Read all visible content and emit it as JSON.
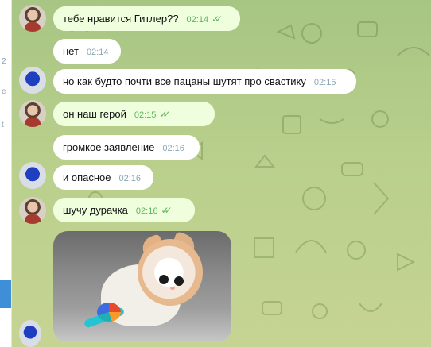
{
  "left_strip": {
    "marks": [
      "2",
      "e",
      "t",
      "."
    ]
  },
  "messages": [
    {
      "text": "тебе нравится Гитлер??",
      "time": "02:14",
      "mine": true
    },
    {
      "text": "нет",
      "time": "02:14",
      "mine": false
    },
    {
      "text": "но как будто почти все пацаны шутят про свастику",
      "time": "02:15",
      "mine": false
    },
    {
      "text": "он наш герой",
      "time": "02:15",
      "mine": true
    },
    {
      "text": "громкое заявление",
      "time": "02:16",
      "mine": false
    },
    {
      "text": "и опасное",
      "time": "02:16",
      "mine": false
    },
    {
      "text": "шучу дурачка",
      "time": "02:16",
      "mine": true
    }
  ],
  "colors": {
    "accent": "#5fb35f",
    "chat_bg": "#b9cf8c",
    "blue": "#3f8ed8"
  },
  "icons": {
    "read": "double-check-icon"
  }
}
